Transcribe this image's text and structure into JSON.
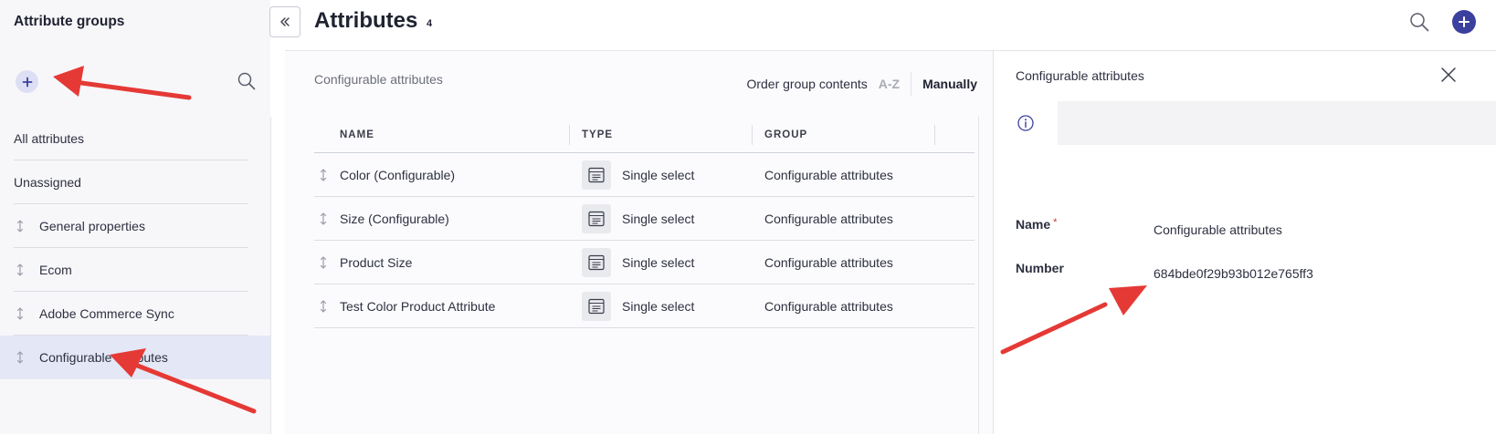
{
  "sidebar": {
    "title": "Attribute groups",
    "items": [
      {
        "label": "All attributes",
        "draggable": false
      },
      {
        "label": "Unassigned",
        "draggable": false
      },
      {
        "label": "General properties",
        "draggable": true
      },
      {
        "label": "Ecom",
        "draggable": true
      },
      {
        "label": "Adobe Commerce Sync",
        "draggable": true
      },
      {
        "label": "Configurable attributes",
        "draggable": true,
        "active": true
      }
    ]
  },
  "header": {
    "title": "Attributes",
    "count": "4"
  },
  "main": {
    "group_title": "Configurable attributes",
    "order": {
      "label": "Order group contents",
      "az": "A-Z",
      "manual": "Manually"
    },
    "columns": [
      "NAME",
      "TYPE",
      "GROUP"
    ],
    "rows": [
      {
        "name": "Color (Configurable)",
        "type": "Single select",
        "group": "Configurable attributes"
      },
      {
        "name": "Size (Configurable)",
        "type": "Single select",
        "group": "Configurable attributes"
      },
      {
        "name": "Product Size",
        "type": "Single select",
        "group": "Configurable attributes"
      },
      {
        "name": "Test Color Product Attribute",
        "type": "Single select",
        "group": "Configurable attributes"
      }
    ]
  },
  "panel": {
    "title": "Configurable attributes",
    "fields": {
      "name_label": "Name",
      "name_required": "*",
      "name_value": "Configurable attributes",
      "number_label": "Number",
      "number_value": "684bde0f29b93b012e765ff3"
    }
  },
  "icons": {
    "add": "plus-icon",
    "search": "search-icon",
    "collapse": "double-chevron-left-icon",
    "drag": "drag-handle-icon",
    "type": "single-select-icon",
    "close": "close-icon",
    "info": "info-icon"
  },
  "colors": {
    "accent": "#3b3f9e",
    "active_bg": "#e4e7f5",
    "annotation": "#e53935"
  }
}
